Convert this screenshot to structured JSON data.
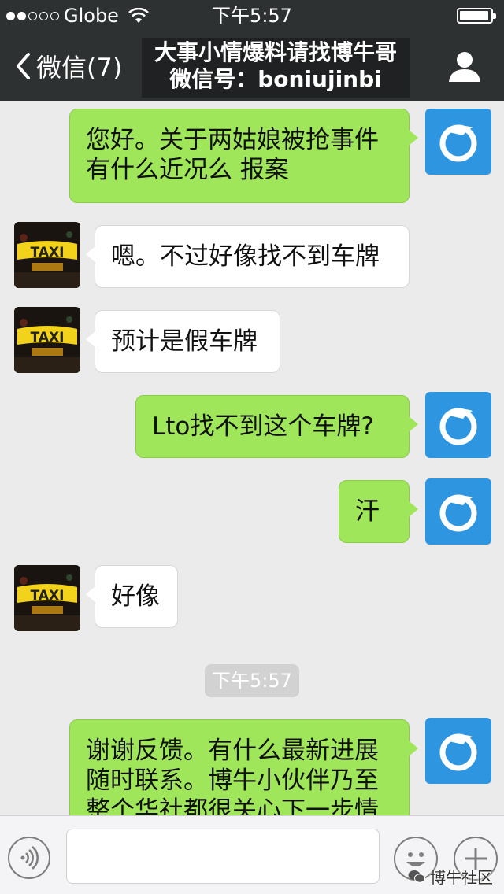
{
  "status_bar": {
    "carrier": "Globe",
    "time": "下午5:57"
  },
  "nav": {
    "back_label": "微信(7)",
    "title_line1": "大事小情爆料请找博牛哥",
    "title_line2": "微信号：boniujinbi"
  },
  "messages": [
    {
      "sender": "me",
      "text_lines": [
        "您好。关于两姑娘被抢事件",
        " 有什么近况么 报案"
      ]
    },
    {
      "sender": "other",
      "text": "嗯。不过好像找不到车牌"
    },
    {
      "sender": "other",
      "text": "预计是假车牌"
    },
    {
      "sender": "me",
      "text": "Lto找不到这个车牌?"
    },
    {
      "sender": "me",
      "text": "汗"
    },
    {
      "sender": "other",
      "text": "好像"
    },
    {
      "sender": "me",
      "text_lines": [
        "谢谢反馈。有什么最新进展",
        "随时联系。博牛小伙伴乃至",
        "整个华社都很关心下一步情"
      ]
    }
  ],
  "timestamp": "下午5:57",
  "avatar_text": "TAXI",
  "watermark": "博牛社区",
  "colors": {
    "nav_bg": "#2e3132",
    "my_bubble": "#9fe65b",
    "their_bubble": "#ffffff",
    "chat_bg": "#ebebeb",
    "bull_avatar": "#2e96e0"
  }
}
